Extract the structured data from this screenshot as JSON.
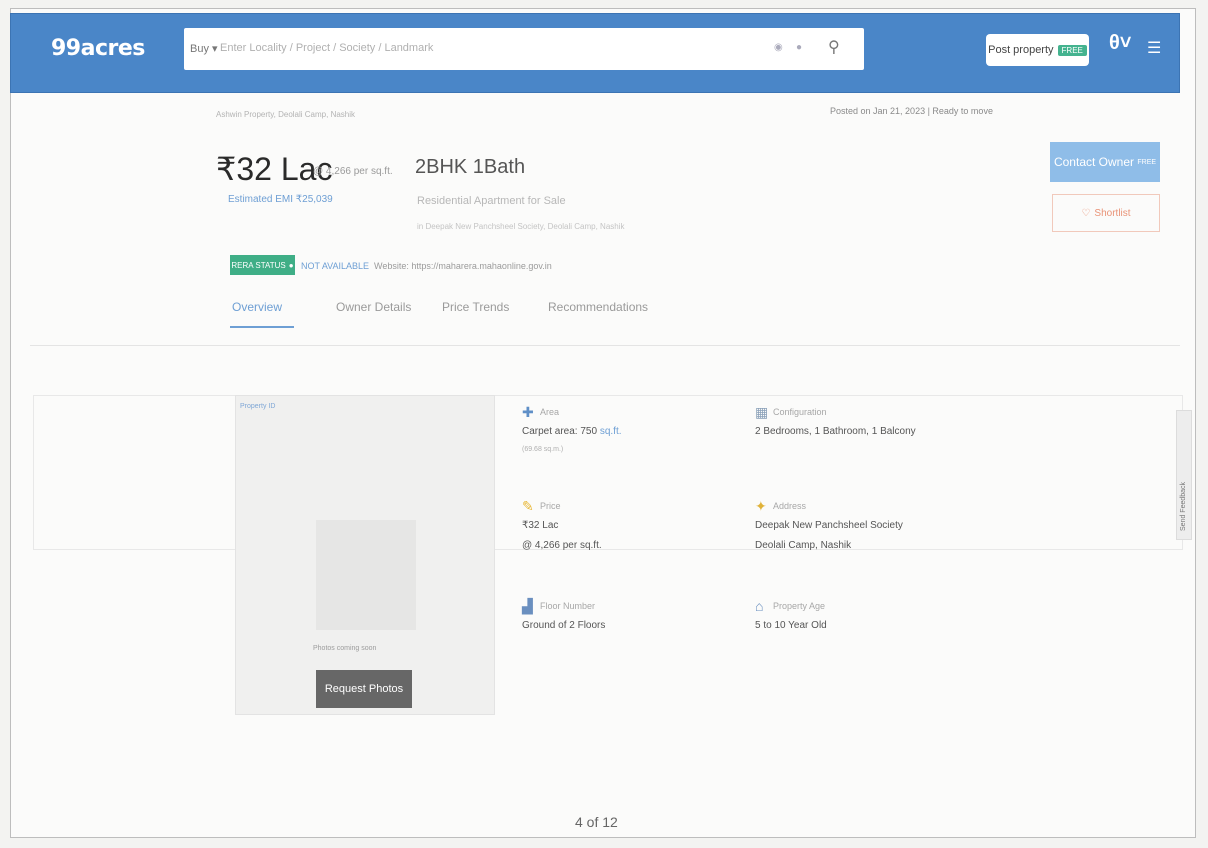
{
  "header": {
    "logo": "99acres",
    "search_mode": "Buy",
    "search_placeholder": "Enter Locality / Project / Society / Landmark",
    "post_property_label": "Post property",
    "post_property_tag": "FREE"
  },
  "listing": {
    "subtitle_strip": "Ashwin Property, Deolali Camp, Nashik",
    "posted_info": "Posted on Jan 21, 2023  |  Ready to move",
    "price": "₹32 Lac",
    "price_per_sqft": "@ 4,266 per sq.ft.",
    "emi": "Estimated EMI ₹25,039",
    "configuration": "2BHK 1Bath",
    "property_type": "Residential Apartment for Sale",
    "property_sub": "in Deepak New Panchsheel Society, Deolali Camp, Nashik",
    "contact_label": "Contact Owner",
    "contact_tag": "FREE",
    "shortlist_label": "Shortlist",
    "rera_label": "RERA STATUS",
    "rera_value": "NOT AVAILABLE",
    "rera_website": "Website: https://maharera.mahaonline.gov.in"
  },
  "tabs": [
    {
      "label": "Overview"
    },
    {
      "label": "Owner Details"
    },
    {
      "label": "Price Trends"
    },
    {
      "label": "Recommendations"
    }
  ],
  "photos": {
    "caption": "Property ID",
    "note": "Photos coming soon",
    "request_label": "Request Photos"
  },
  "specs": {
    "area": {
      "label": "Area",
      "value": "Carpet area: 750",
      "unit": "sq.ft.",
      "extra": "(69.68 sq.m.)"
    },
    "configuration": {
      "label": "Configuration",
      "value": "2 Bedrooms, 1 Bathroom, 1 Balcony"
    },
    "price": {
      "label": "Price",
      "value": "₹32 Lac",
      "value2": "@ 4,266 per sq.ft."
    },
    "address": {
      "label": "Address",
      "value": "Deepak New Panchsheel Society",
      "value2": "Deolali Camp, Nashik"
    },
    "floor": {
      "label": "Floor Number",
      "value": "Ground of 2 Floors"
    },
    "age": {
      "label": "Property Age",
      "value": "5 to 10 Year Old"
    }
  },
  "feedback_label": "Send Feedback",
  "page_counter": "4 of 12",
  "colors": {
    "brand": "#4a86c8",
    "accent": "#6e9fd4",
    "rera_green": "#3fae86"
  }
}
